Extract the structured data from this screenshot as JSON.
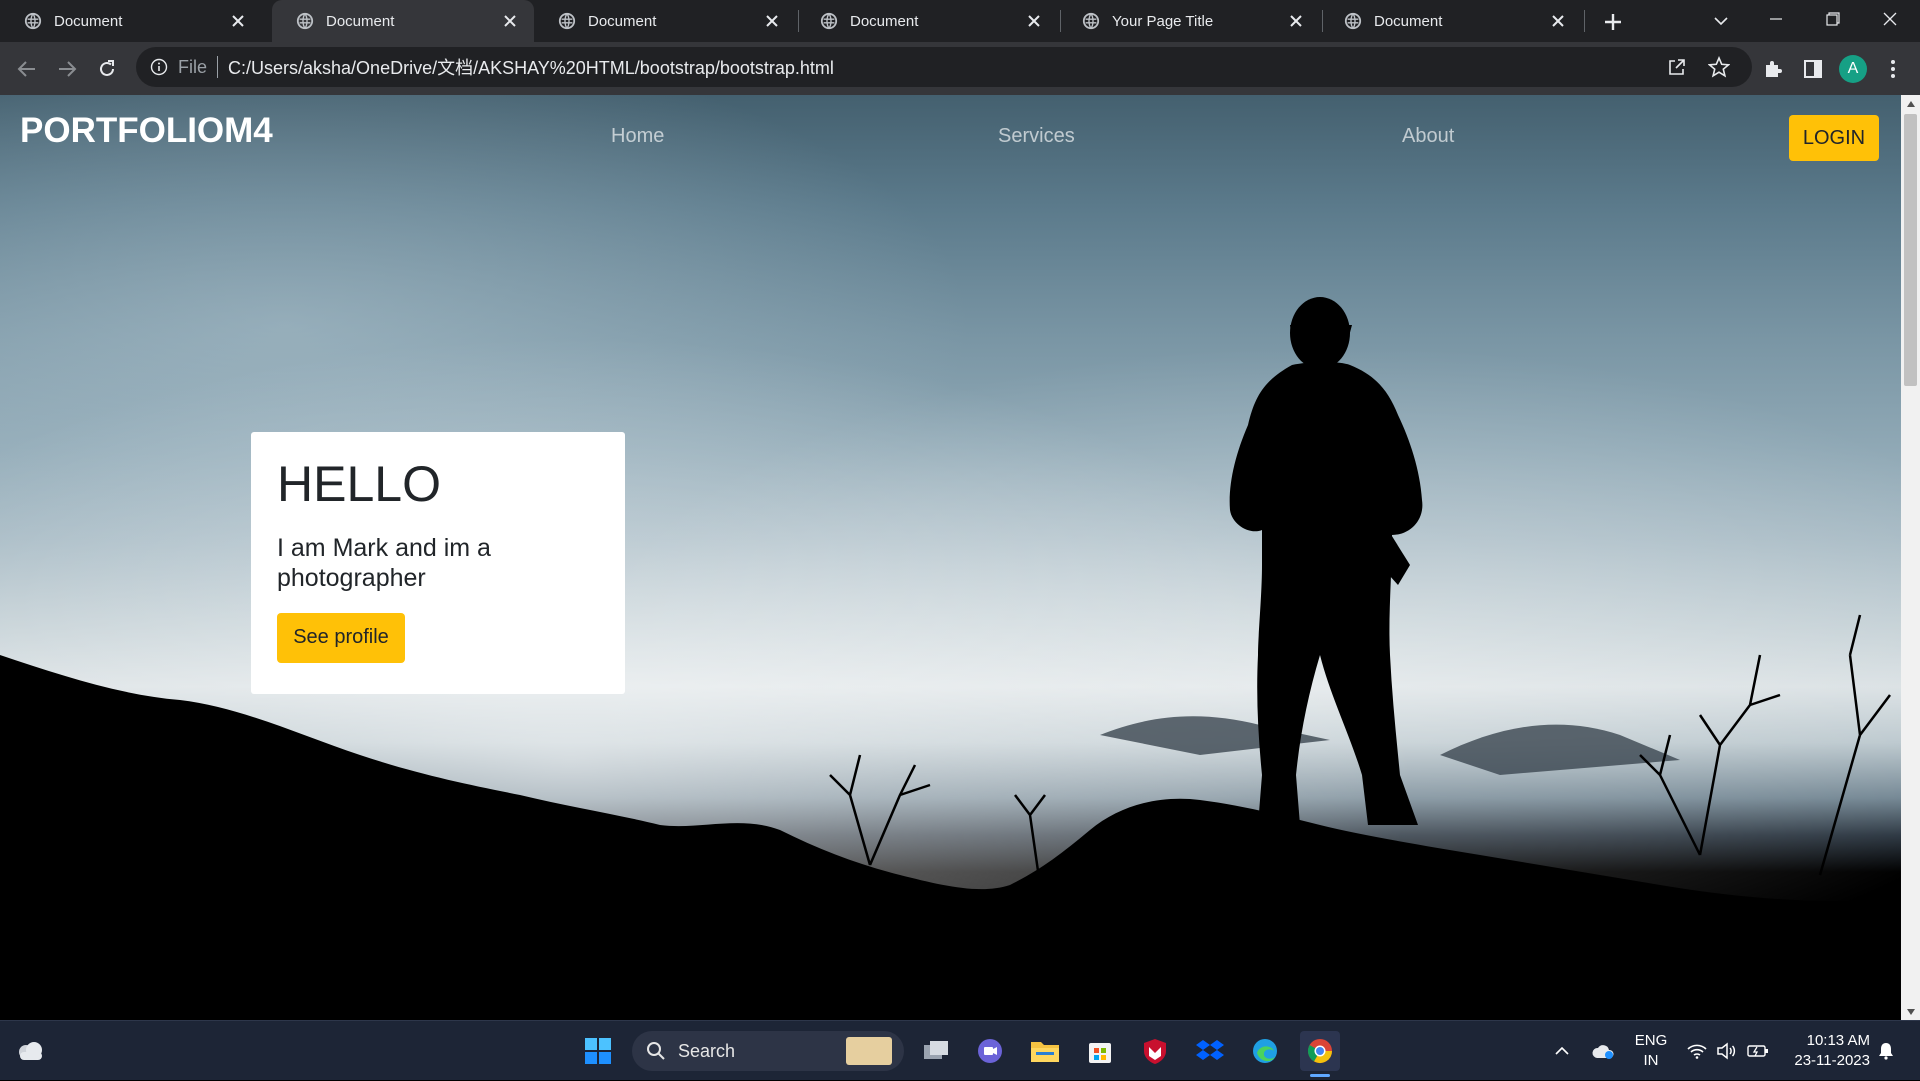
{
  "browser": {
    "tabs": [
      {
        "title": "Document",
        "active": false
      },
      {
        "title": "Document",
        "active": true
      },
      {
        "title": "Document",
        "active": false
      },
      {
        "title": "Document",
        "active": false
      },
      {
        "title": "Your Page Title",
        "active": false
      },
      {
        "title": "Document",
        "active": false
      }
    ],
    "address": {
      "scheme_label": "File",
      "url": "C:/Users/aksha/OneDrive/文档/AKSHAY%20HTML/bootstrap/bootstrap.html"
    },
    "profile_initial": "A"
  },
  "page": {
    "brand": "PORTFOLIOM4",
    "nav": {
      "home": "Home",
      "services": "Services",
      "about": "About",
      "login": "LOGIN"
    },
    "hero": {
      "title": "HELLO",
      "subtitle": "I am Mark and im a photographer",
      "button": "See profile"
    },
    "colors": {
      "accent": "#ffc107",
      "card": "#ffffff"
    },
    "scroll_position": 0
  },
  "taskbar": {
    "search_placeholder": "Search",
    "language_top": "ENG",
    "language_bottom": "IN",
    "time": "10:13 AM",
    "date": "23-11-2023"
  }
}
